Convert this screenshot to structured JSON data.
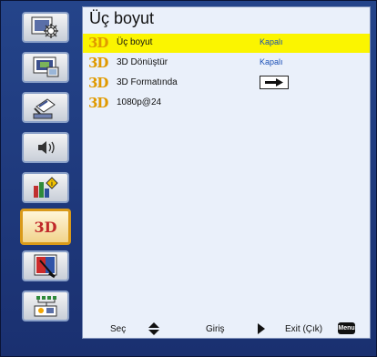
{
  "title": "Üç boyut",
  "rows": [
    {
      "badge": "3D",
      "label": "Üç boyut",
      "value": "Kapalı",
      "selected": true
    },
    {
      "badge": "3D",
      "label": "3D Dönüştür",
      "value": "Kapalı"
    },
    {
      "badge": "3D",
      "label": "3D Formatında",
      "value_icon": "right-arrow-icon"
    },
    {
      "badge": "3D",
      "label": "1080p@24"
    }
  ],
  "sidebar": {
    "items": [
      {
        "icon": "image-settings-icon"
      },
      {
        "icon": "display-settings-icon"
      },
      {
        "icon": "setup-icon"
      },
      {
        "icon": "volume-icon"
      },
      {
        "icon": "options-icon"
      },
      {
        "icon": "3d-icon",
        "label": "3D",
        "active": true
      },
      {
        "icon": "lamp-settings-icon"
      },
      {
        "icon": "network-icon"
      }
    ]
  },
  "footer": {
    "select_label": "Seç",
    "enter_label": "Giriş",
    "exit_label": "Exit (Çık)",
    "menu_key": "Menu"
  }
}
